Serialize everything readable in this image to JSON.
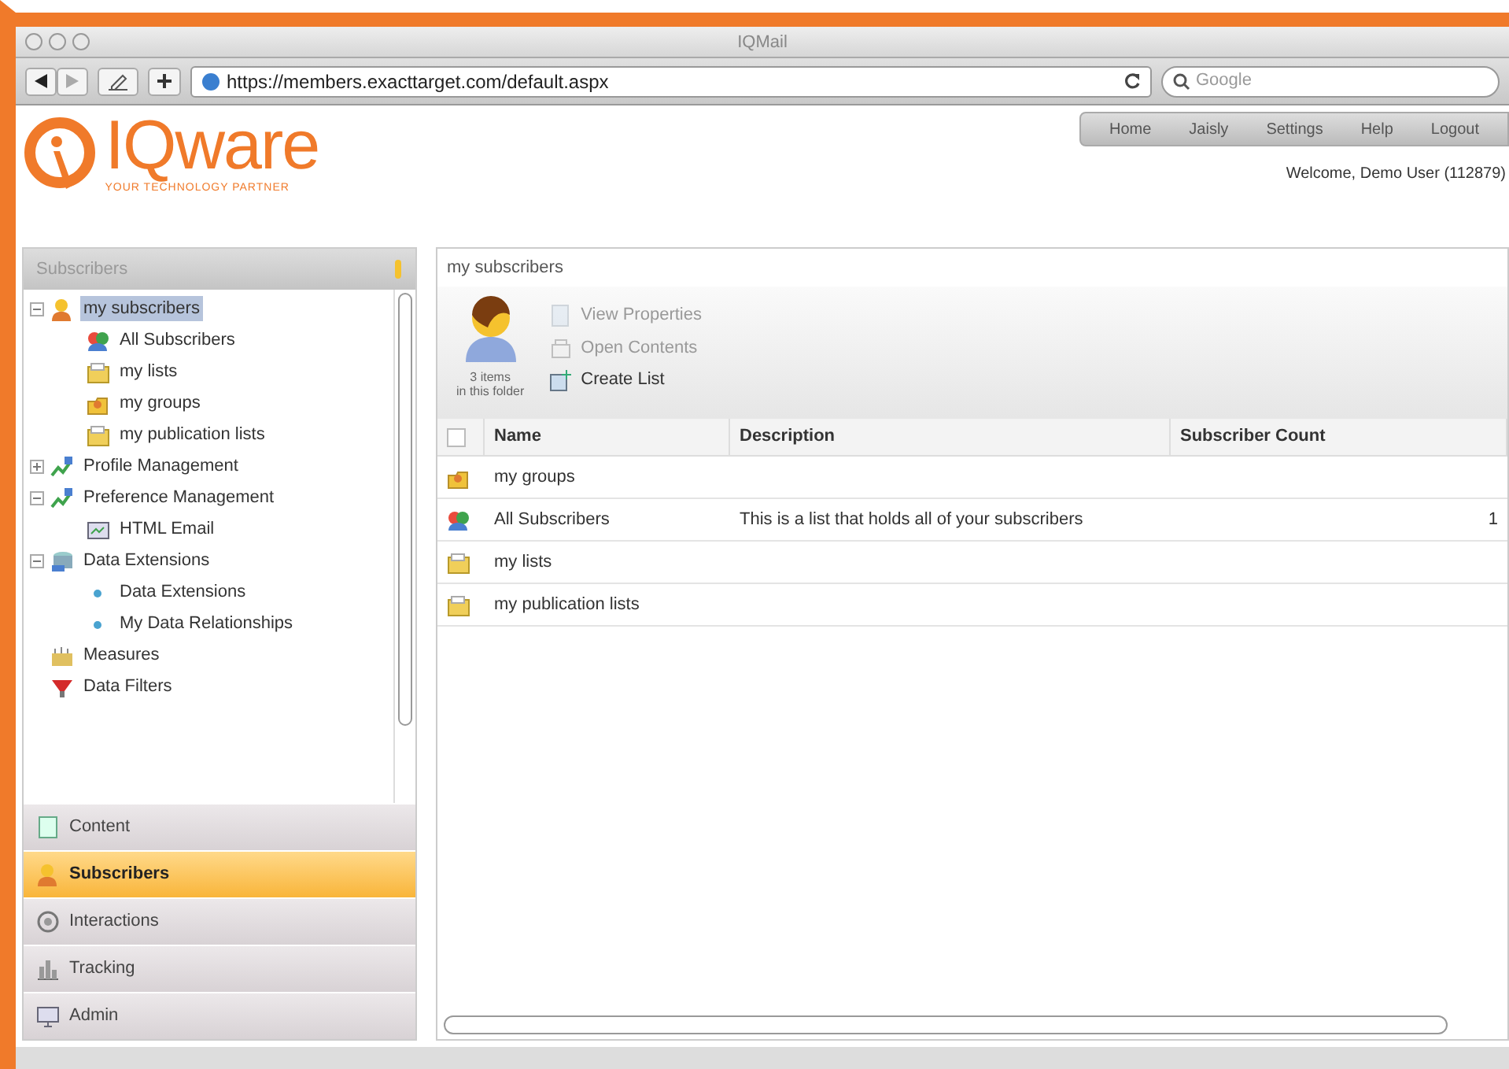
{
  "window": {
    "title": "IQMail"
  },
  "browser": {
    "url": "https://members.exacttarget.com/default.aspx",
    "search_placeholder": "Google"
  },
  "logo": {
    "name": "IQware",
    "tagline": "YOUR TECHNOLOGY PARTNER"
  },
  "top_nav": [
    "Home",
    "Jaisly",
    "Settings",
    "Help",
    "Logout"
  ],
  "welcome": "Welcome, Demo User (112879)",
  "sidebar": {
    "title": "Subscribers",
    "tree": [
      {
        "label": "my subscribers",
        "kind": "person",
        "expanded": true,
        "selected": true,
        "children": [
          {
            "label": "All Subscribers",
            "kind": "group",
            "selected": false
          },
          {
            "label": "my lists",
            "kind": "list",
            "selected": false
          },
          {
            "label": "my groups",
            "kind": "folder",
            "selected": false
          },
          {
            "label": "my publication lists",
            "kind": "list",
            "selected": false
          }
        ]
      },
      {
        "label": "Profile Management",
        "kind": "profile",
        "expanded": false,
        "selected": false
      },
      {
        "label": "Preference Management",
        "kind": "profile",
        "expanded": true,
        "selected": false,
        "children": [
          {
            "label": "HTML Email",
            "kind": "email",
            "selected": false
          }
        ]
      },
      {
        "label": "Data Extensions",
        "kind": "data",
        "expanded": true,
        "selected": false,
        "children": [
          {
            "label": "Data Extensions",
            "kind": "dot",
            "selected": false
          },
          {
            "label": "My Data Relationships",
            "kind": "dot",
            "selected": false
          }
        ]
      },
      {
        "label": "Measures",
        "kind": "measures",
        "selected": false
      },
      {
        "label": "Data Filters",
        "kind": "filter",
        "selected": false
      }
    ],
    "sections": [
      {
        "label": "Content",
        "kind": "content",
        "selected": false
      },
      {
        "label": "Subscribers",
        "kind": "person",
        "selected": true
      },
      {
        "label": "Interactions",
        "kind": "gear",
        "selected": false
      },
      {
        "label": "Tracking",
        "kind": "chart",
        "selected": false
      },
      {
        "label": "Admin",
        "kind": "monitor",
        "selected": false
      }
    ]
  },
  "content": {
    "title": "my subscribers",
    "count": "3",
    "count_unit": "items",
    "count_note": "in this folder",
    "actions": [
      {
        "label": "View Properties",
        "disabled": true
      },
      {
        "label": "Open Contents",
        "disabled": true
      },
      {
        "label": "Create List",
        "disabled": false
      }
    ],
    "table": {
      "select_all_checked": false,
      "columns": [
        "Name",
        "Description",
        "Subscriber Count"
      ],
      "rows": [
        {
          "kind": "folder",
          "name": "my groups"
        },
        {
          "kind": "group",
          "name": "All Subscribers",
          "description": "This is a list that holds all of your subscribers",
          "count": "1"
        },
        {
          "kind": "list",
          "name": "my lists"
        },
        {
          "kind": "list",
          "name": "my publication lists"
        }
      ]
    }
  }
}
